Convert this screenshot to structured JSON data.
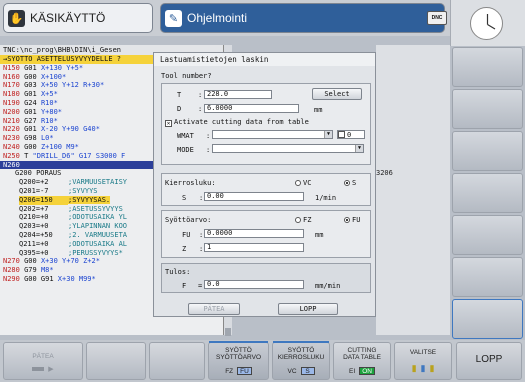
{
  "modes": {
    "left": "KÄSIKÄYTTÖ",
    "right": "Ohjelmointi",
    "dnc": "DNC"
  },
  "program": {
    "path": "TNC:\\nc_prog\\BHB\\DIN\\i_Gesen",
    "header": "→SYOTTO ASETTELUSYVYYDELLE ?",
    "lines": [
      {
        "n": "N150",
        "t": " G01 ",
        "rest": "X+130 Y+5*"
      },
      {
        "n": "N160",
        "t": " G00 ",
        "rest": "X+100*"
      },
      {
        "n": "N170",
        "t": " G03 ",
        "rest": "X+50 Y+12 R+30*"
      },
      {
        "n": "N180",
        "t": " G01 ",
        "rest": "X+5*"
      },
      {
        "n": "N190",
        "t": " G24 ",
        "rest": "R10*"
      },
      {
        "n": "N200",
        "t": " G01 ",
        "rest": "Y+80*"
      },
      {
        "n": "N210",
        "t": " G27 ",
        "rest": "R10*"
      },
      {
        "n": "N220",
        "t": " G01 ",
        "rest": "X-20 Y+90 G40*"
      },
      {
        "n": "N230",
        "t": " G98 ",
        "rest": "L0*"
      },
      {
        "n": "N240",
        "t": " G00 ",
        "rest": "Z+100 M9*"
      },
      {
        "n": "N250",
        "t": " T ",
        "rest": "\"DRILL_D6\" G17 S3000 F"
      },
      {
        "n": "N260",
        "t": "",
        "rest": "",
        "sel": true
      }
    ],
    "cycle": "G200 PORAUS",
    "params": [
      {
        "p": "Q200=+2",
        "c": ";VARMUUSETAISY"
      },
      {
        "p": "Q201=-7",
        "c": ";SYVYYS"
      },
      {
        "p": "Q206=150",
        "c": ";SYVYYSAS.",
        "hl": true
      },
      {
        "p": "Q202=+7",
        "c": ";ASETUSSYVYYS"
      },
      {
        "p": "Q210=+0",
        "c": ";ODOTUSAIKA YL"
      },
      {
        "p": "Q203=+0",
        "c": ";YLAPINNAN KOO"
      },
      {
        "p": "Q204=+50",
        "c": ";2. VARMUUSETA"
      },
      {
        "p": "Q211=+0",
        "c": ";ODOTUSAIKA AL"
      },
      {
        "p": "Q395=+0",
        "c": ";PERUSSYVYYS*"
      }
    ],
    "tail": [
      {
        "n": "N270",
        "t": " G00 ",
        "rest": "X+30 Y+70 Z+2*"
      },
      {
        "n": "N280",
        "t": " G79 ",
        "rest": "M8*"
      },
      {
        "n": "N290",
        "t": " G00 G91 ",
        "rest": "X+30 M99*"
      }
    ],
    "side_value": "3206"
  },
  "dialog": {
    "title": "Lastuamistietojen laskin",
    "tool_label": "Tool number?",
    "t_label": "T",
    "t_value": "228.0",
    "select_btn": "Select",
    "d_label": "D",
    "d_value": "6.0000",
    "d_unit": "mm",
    "activate_label": "Activate cutting data from table",
    "activate_checked": true,
    "wmat_label": "WMAT",
    "wmat_value": "",
    "wmat_num": "0",
    "mode_label": "MODE",
    "mode_value": "",
    "speed_title": "Kierrosluku:",
    "vc_label": "VC",
    "s_label": "S",
    "s_radio_label": "S",
    "s_value": "0.00",
    "s_unit": "1/min",
    "feed_title": "Syöttöarvo:",
    "fz_label": "FZ",
    "fu_label": "FU",
    "fu_input_label": "FU",
    "fu_value": "0.0000",
    "fu_unit": "mm",
    "z_label": "Z",
    "z_value": "1",
    "result_title": "Tulos:",
    "f_label": "F",
    "f_value": "0.0",
    "f_unit": "mm/min",
    "apply_btn": "PÄTEA",
    "end_btn": "LOPP"
  },
  "softkeys": {
    "pate": "PÄTEA",
    "sk1_l1": "SYÖTTÖ",
    "sk1_l2": "SYÖTTÖARVO",
    "sk1_a": "FZ",
    "sk1_b": "FU",
    "sk2_l1": "SYÖTTÖ",
    "sk2_l2": "KIERROSLUKU",
    "sk2_a": "VC",
    "sk2_b": "S",
    "sk3_l1": "CUTTING",
    "sk3_l2": "DATA TABLE",
    "sk3_a": "EI",
    "sk3_b": "ON",
    "sk4": "VALITSE",
    "lopp": "LOPP"
  },
  "colors": {
    "accent": "#2f5f9a",
    "highlight": "#f5d23a",
    "active_on": "#1ba23d"
  }
}
